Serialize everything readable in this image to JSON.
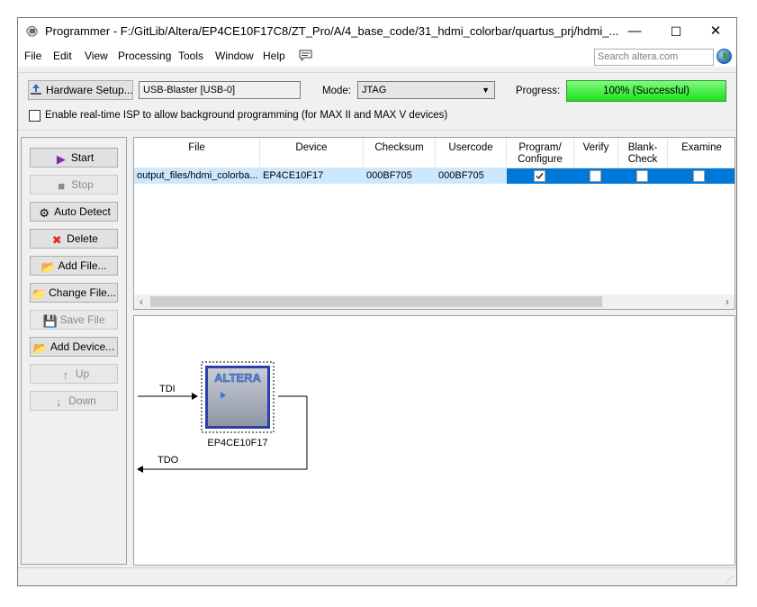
{
  "titlebar": {
    "title": "Programmer - F:/GitLib/Altera/EP4CE10F17C8/ZT_Pro/A/4_base_code/31_hdmi_colorbar/quartus_prj/hdmi_...",
    "minimize": "—",
    "maximize": "☐",
    "close": "✕"
  },
  "menu": {
    "items": [
      "File",
      "Edit",
      "View",
      "Processing",
      "Tools",
      "Window",
      "Help"
    ],
    "search_placeholder": "Search altera.com"
  },
  "hardware": {
    "setup_label": "Hardware Setup...",
    "device_value": "USB-Blaster [USB-0]",
    "mode_label": "Mode:",
    "mode_value": "JTAG",
    "progress_label": "Progress:",
    "progress_text": "100% (Successful)",
    "progress_fraction": 1.0,
    "isp_label": "Enable real-time ISP to allow background programming (for MAX II and MAX V devices)"
  },
  "actions": {
    "start": "Start",
    "stop": "Stop",
    "auto_detect": "Auto Detect",
    "delete": "Delete",
    "add_file": "Add File...",
    "change_file": "Change File...",
    "save_file": "Save File",
    "add_device": "Add Device...",
    "up": "Up",
    "down": "Down"
  },
  "table": {
    "headers": [
      "File",
      "Device",
      "Checksum",
      "Usercode",
      "Program/\nConfigure",
      "Verify",
      "Blank-\nCheck",
      "Examine"
    ],
    "rows": [
      {
        "file": "output_files/hdmi_colorba...",
        "device": "EP4CE10F17",
        "checksum": "000BF705",
        "usercode": "000BF705",
        "program": true,
        "verify": false,
        "blank_check": false,
        "examine": false
      }
    ]
  },
  "diagram": {
    "tdi": "TDI",
    "tdo": "TDO",
    "chip_label": "EP4CE10F17",
    "logo_text": "ALTERA"
  },
  "colors": {
    "selection": "#0078d7",
    "row_highlight": "#cce8ff",
    "progress": "#32e632"
  }
}
